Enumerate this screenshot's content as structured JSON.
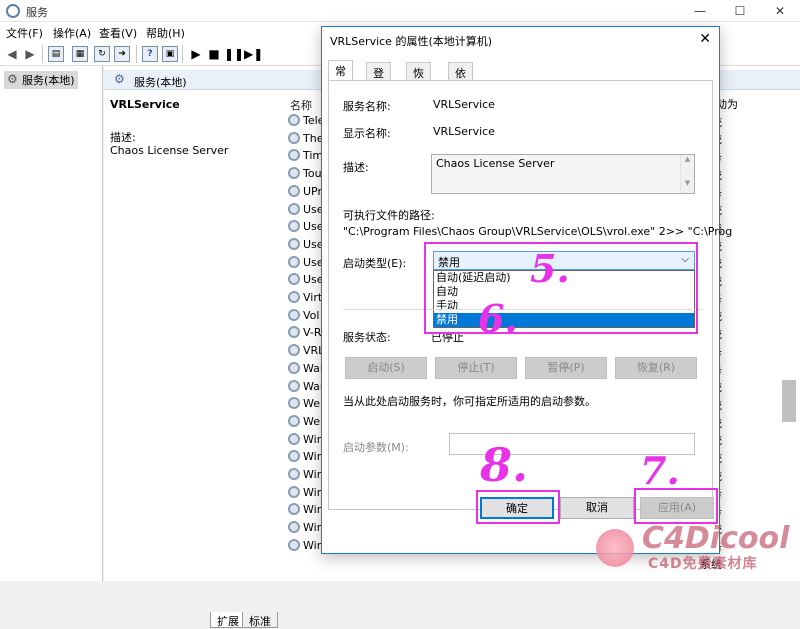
{
  "window": {
    "title": "服务"
  },
  "menu": [
    "文件(F)",
    "操作(A)",
    "查看(V)",
    "帮助(H)"
  ],
  "tree": {
    "root": "服务(本地)"
  },
  "pane": {
    "header": "服务(本地)",
    "selected_service": "VRLService",
    "desc_label": "描述:",
    "desc": "Chaos License Server",
    "col_name": "名称",
    "col_right": "启动类型"
  },
  "services": [
    "Tele",
    "The",
    "Tim",
    "Tou",
    "UPn",
    "Use",
    "Use",
    "Use",
    "Use",
    "Use",
    "Virt",
    "Vol",
    "V-R",
    "VRL",
    "Wal",
    "War",
    "Wel",
    "Wel",
    "Win",
    "Win",
    "Win",
    "Win",
    "Win",
    "Windows Connection Manager",
    "Windows Defender Advanced Threat Protection Se..."
  ],
  "service_right_col": [
    "动为",
    "系统",
    "系统",
    "服务",
    "系统",
    "服务",
    "系统",
    "系统",
    "系统",
    "系统",
    "系统",
    "服务",
    "系统",
    "系统",
    "服务",
    "服务",
    "系统",
    "系统",
    "系统",
    "系统",
    "系统",
    "系统",
    "服务",
    "服务",
    "系统",
    "服务",
    "系统"
  ],
  "bottom_tabs": [
    "扩展",
    "标准"
  ],
  "dialog": {
    "title": "VRLService 的属性(本地计算机)",
    "tabs": [
      "常规",
      "登录",
      "恢复",
      "依存关系"
    ],
    "service_name_label": "服务名称:",
    "service_name": "VRLService",
    "display_name_label": "显示名称:",
    "display_name": "VRLService",
    "desc_label": "描述:",
    "desc": "Chaos License Server",
    "exe_path_label": "可执行文件的路径:",
    "exe_path": "\"C:\\Program Files\\Chaos Group\\VRLService\\OLS\\vrol.exe\" 2>> \"C:\\Prog",
    "startup_type_label": "启动类型(E):",
    "startup_type_value": "禁用",
    "startup_options": [
      "自动(延迟启动)",
      "自动",
      "手动",
      "禁用"
    ],
    "service_status_label": "服务状态:",
    "service_status": "已停止",
    "buttons": {
      "start": "启动(S)",
      "stop": "停止(T)",
      "pause": "暂停(P)",
      "resume": "恢复(R)"
    },
    "hint": "当从此处启动服务时，你可指定所适用的启动参数。",
    "start_params_label": "启动参数(M):",
    "ok": "确定",
    "cancel": "取消",
    "apply": "应用(A)"
  },
  "annotations": {
    "n5": "5.",
    "n6": "6.",
    "n7": "7.",
    "n8": "8."
  },
  "watermark": {
    "logo": "C4Dicool",
    "sub": "C4D免费素材库"
  },
  "colors": {
    "annotation": "#e832e8",
    "selection": "#0078d7",
    "dialog_border": "#1979ca"
  }
}
